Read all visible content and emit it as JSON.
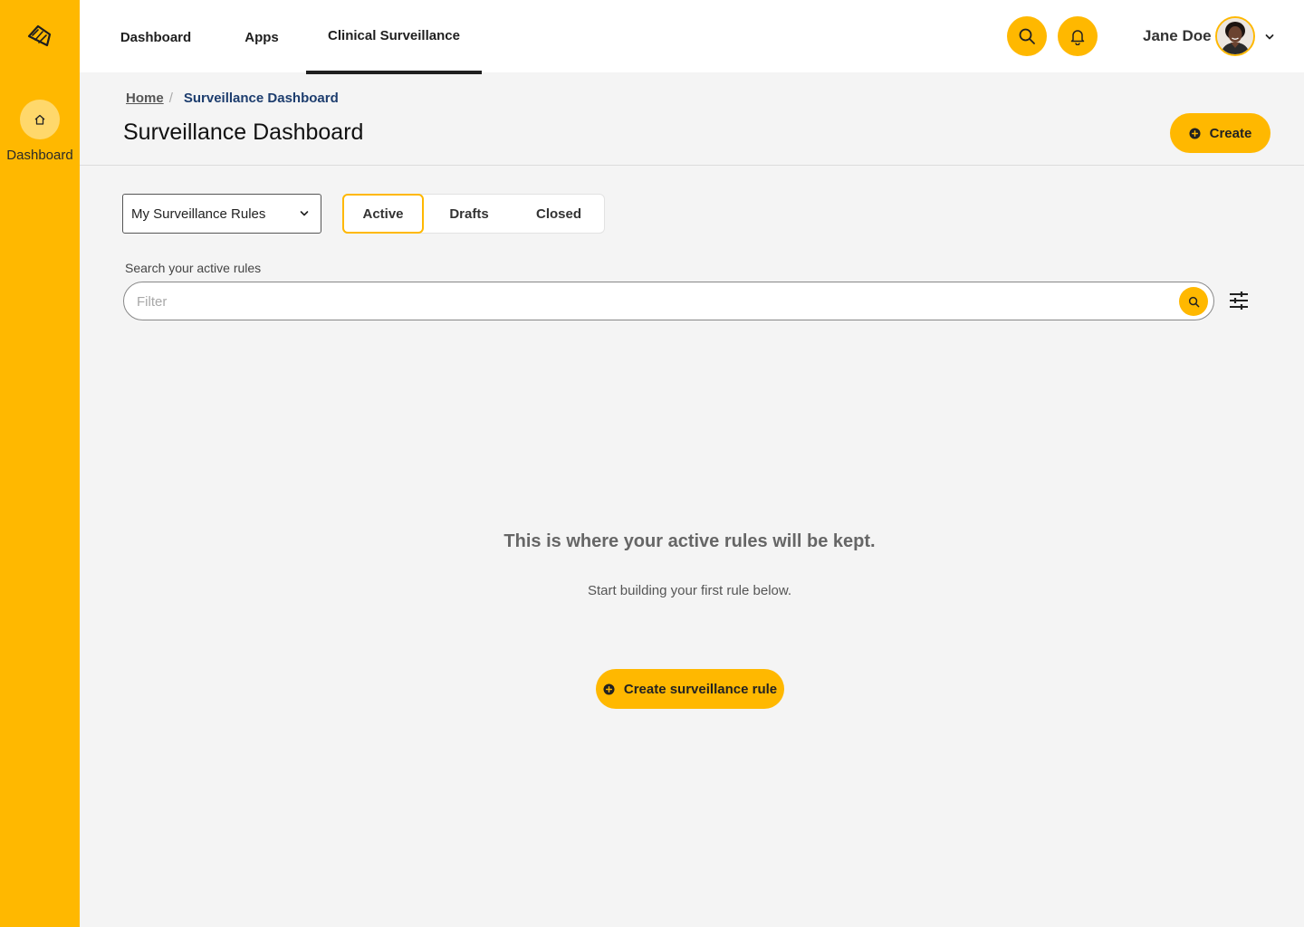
{
  "sidebar": {
    "logo_icon": "brand-logo",
    "items": [
      {
        "label": "Dashboard",
        "icon": "home-icon"
      }
    ]
  },
  "topnav": {
    "tabs": [
      {
        "label": "Dashboard"
      },
      {
        "label": "Apps"
      },
      {
        "label": "Clinical Surveillance",
        "active": true
      }
    ],
    "search_icon": "search-icon",
    "notifications_icon": "bell-icon",
    "user": {
      "name": "Jane Doe",
      "avatar": "user-avatar"
    }
  },
  "breadcrumb": {
    "home": "Home",
    "separator": "/",
    "current": "Surveillance Dashboard"
  },
  "page": {
    "title": "Surveillance Dashboard",
    "create_label": "Create"
  },
  "controls": {
    "rules_select": {
      "value": "My Surveillance Rules"
    },
    "status_tabs": [
      {
        "label": "Active",
        "active": true
      },
      {
        "label": "Drafts"
      },
      {
        "label": "Closed"
      }
    ],
    "search": {
      "label": "Search your active rules",
      "placeholder": "Filter",
      "value": ""
    },
    "filter_icon": "sliders-icon"
  },
  "empty_state": {
    "title": "This is where your active rules will be kept.",
    "subtitle": "Start building your first rule below.",
    "cta_label": "Create surveillance rule"
  },
  "colors": {
    "accent": "#ffb800",
    "accent_light": "#ffd86b",
    "breadcrumb_current": "#1d3d6e"
  }
}
